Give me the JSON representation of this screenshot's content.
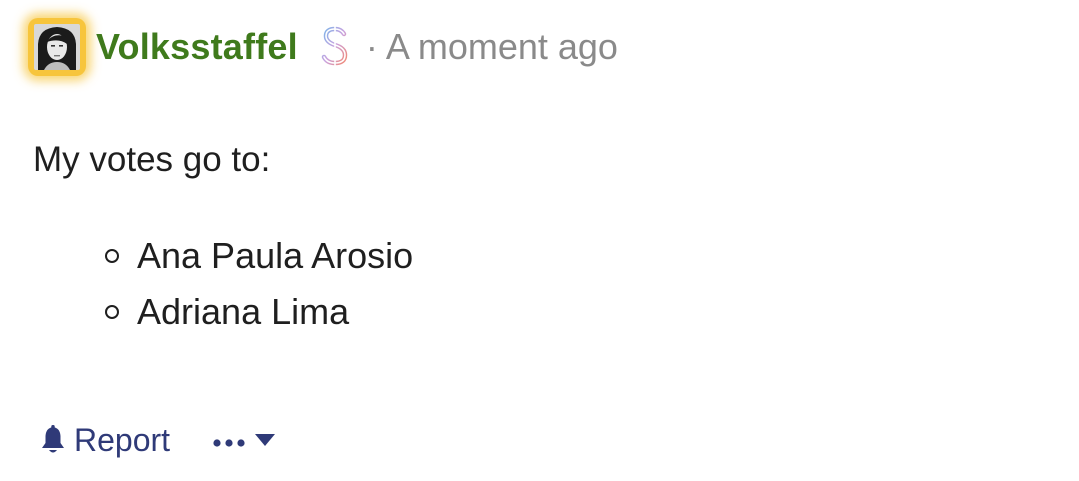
{
  "post": {
    "author": {
      "name": "Volksstaffel",
      "avatar_icon": "user-avatar",
      "badge_icon": "dollar-sign-icon"
    },
    "timestamp": "· A moment ago",
    "intro": "My votes go to:",
    "votes": [
      "Ana Paula Arosio",
      "Adriana Lima"
    ],
    "actions": {
      "report_label": "Report",
      "report_icon": "bell-icon",
      "more_icon": "ellipsis-icon",
      "more_dropdown_icon": "chevron-down-icon"
    }
  },
  "colors": {
    "username": "#3f7a1c",
    "avatar_glow": "#f7c53c",
    "timestamp": "#8a8a8a",
    "action_link": "#2f3a78"
  }
}
